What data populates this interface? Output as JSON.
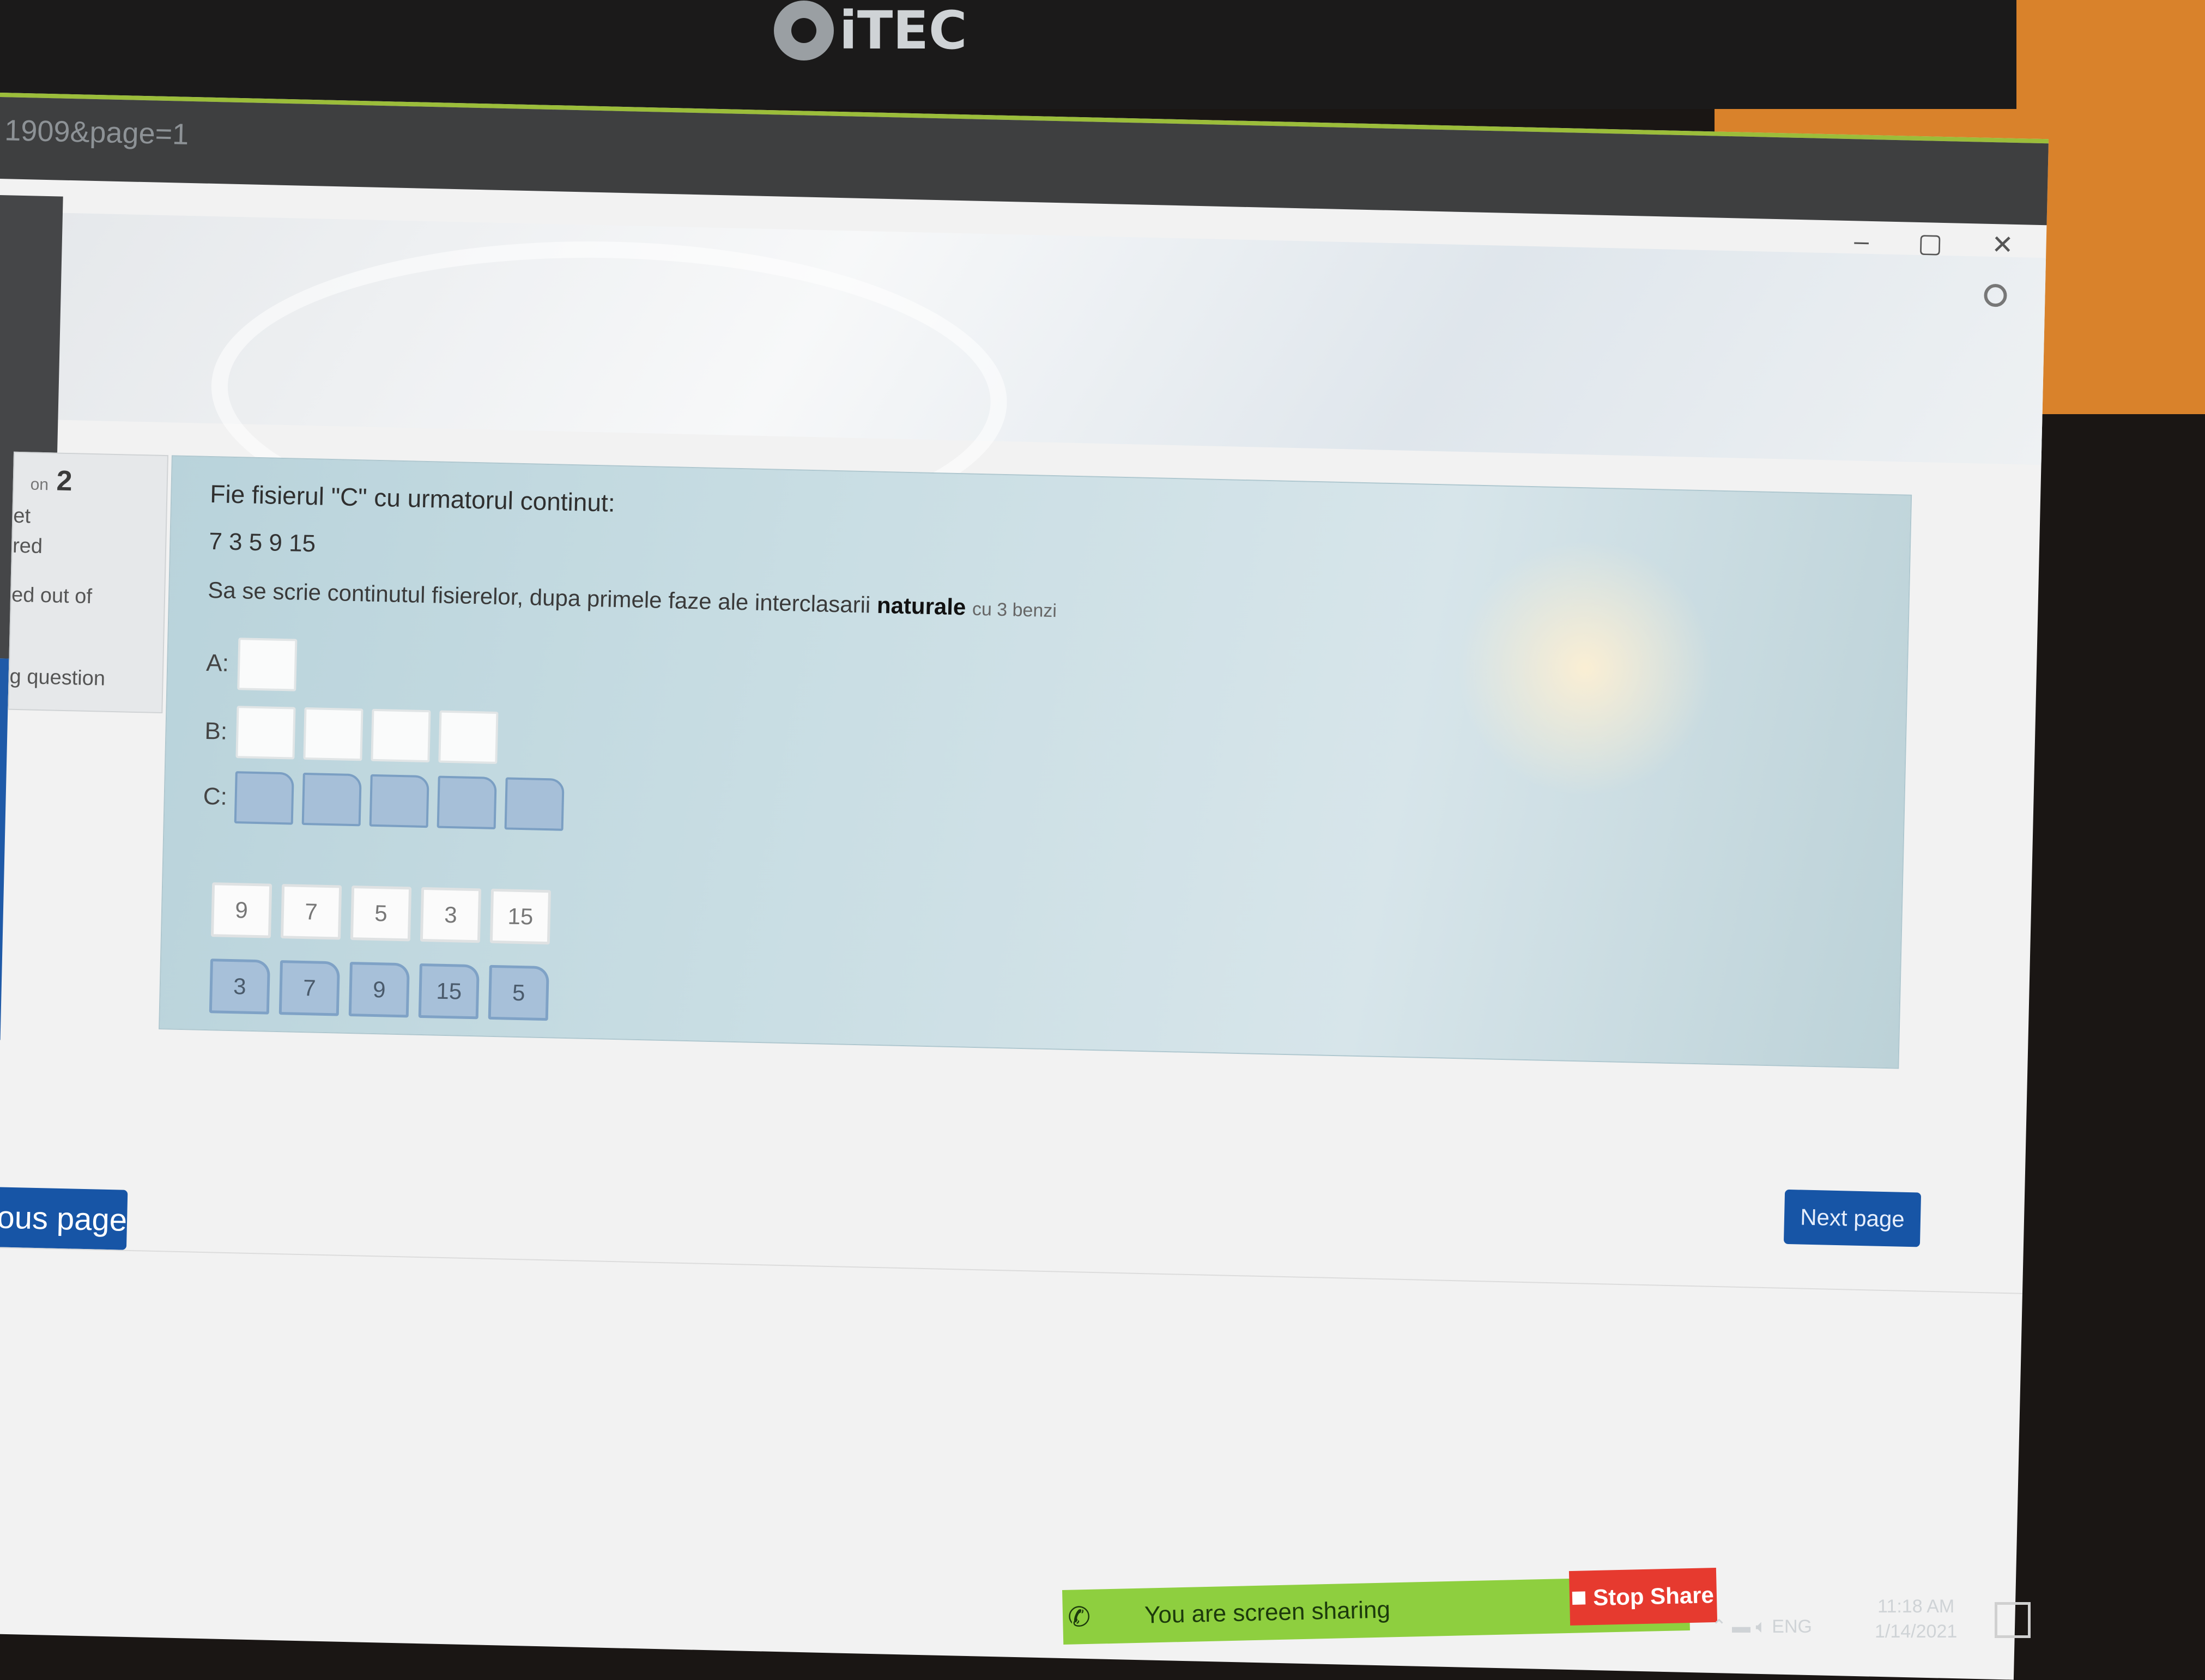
{
  "monitor": {
    "brand": "iTEC"
  },
  "browser": {
    "url_fragment": "1909&page=1"
  },
  "window_controls": {
    "minimize": "–",
    "maximize": "▢",
    "close": "✕"
  },
  "info": {
    "question_prefix": "on",
    "question_number": "2",
    "line1": "et",
    "line2": "red",
    "line3": "ed out of",
    "line4": "g question"
  },
  "question": {
    "title": "Fie fisierul \"C\" cu urmatorul continut:",
    "sequence": "7 3 5 9 15",
    "prompt_before": "Sa se scrie continutul fisierelor, dupa primele faze ale interclasarii",
    "prompt_bold": "naturale",
    "prompt_after": "cu 3 benzi",
    "label_a": "A:",
    "label_b": "B:",
    "label_c": "C:",
    "tiles_white": [
      "9",
      "7",
      "5",
      "3",
      "15"
    ],
    "tiles_blue": [
      "3",
      "7",
      "9",
      "15",
      "5"
    ]
  },
  "nav": {
    "previous": "ious page",
    "next": "Next page"
  },
  "zoom": {
    "sharing_message": "You are screen sharing",
    "stop_share": "Stop Share"
  },
  "taskbar": {
    "language": "ENG",
    "time": "11:18 AM",
    "date": "1/14/2021"
  },
  "colors": {
    "primary_button": "#1755a6",
    "question_bg": "#c8dde3",
    "zoom_bar": "#8ecf3f",
    "stop_share": "#e63a2f"
  }
}
